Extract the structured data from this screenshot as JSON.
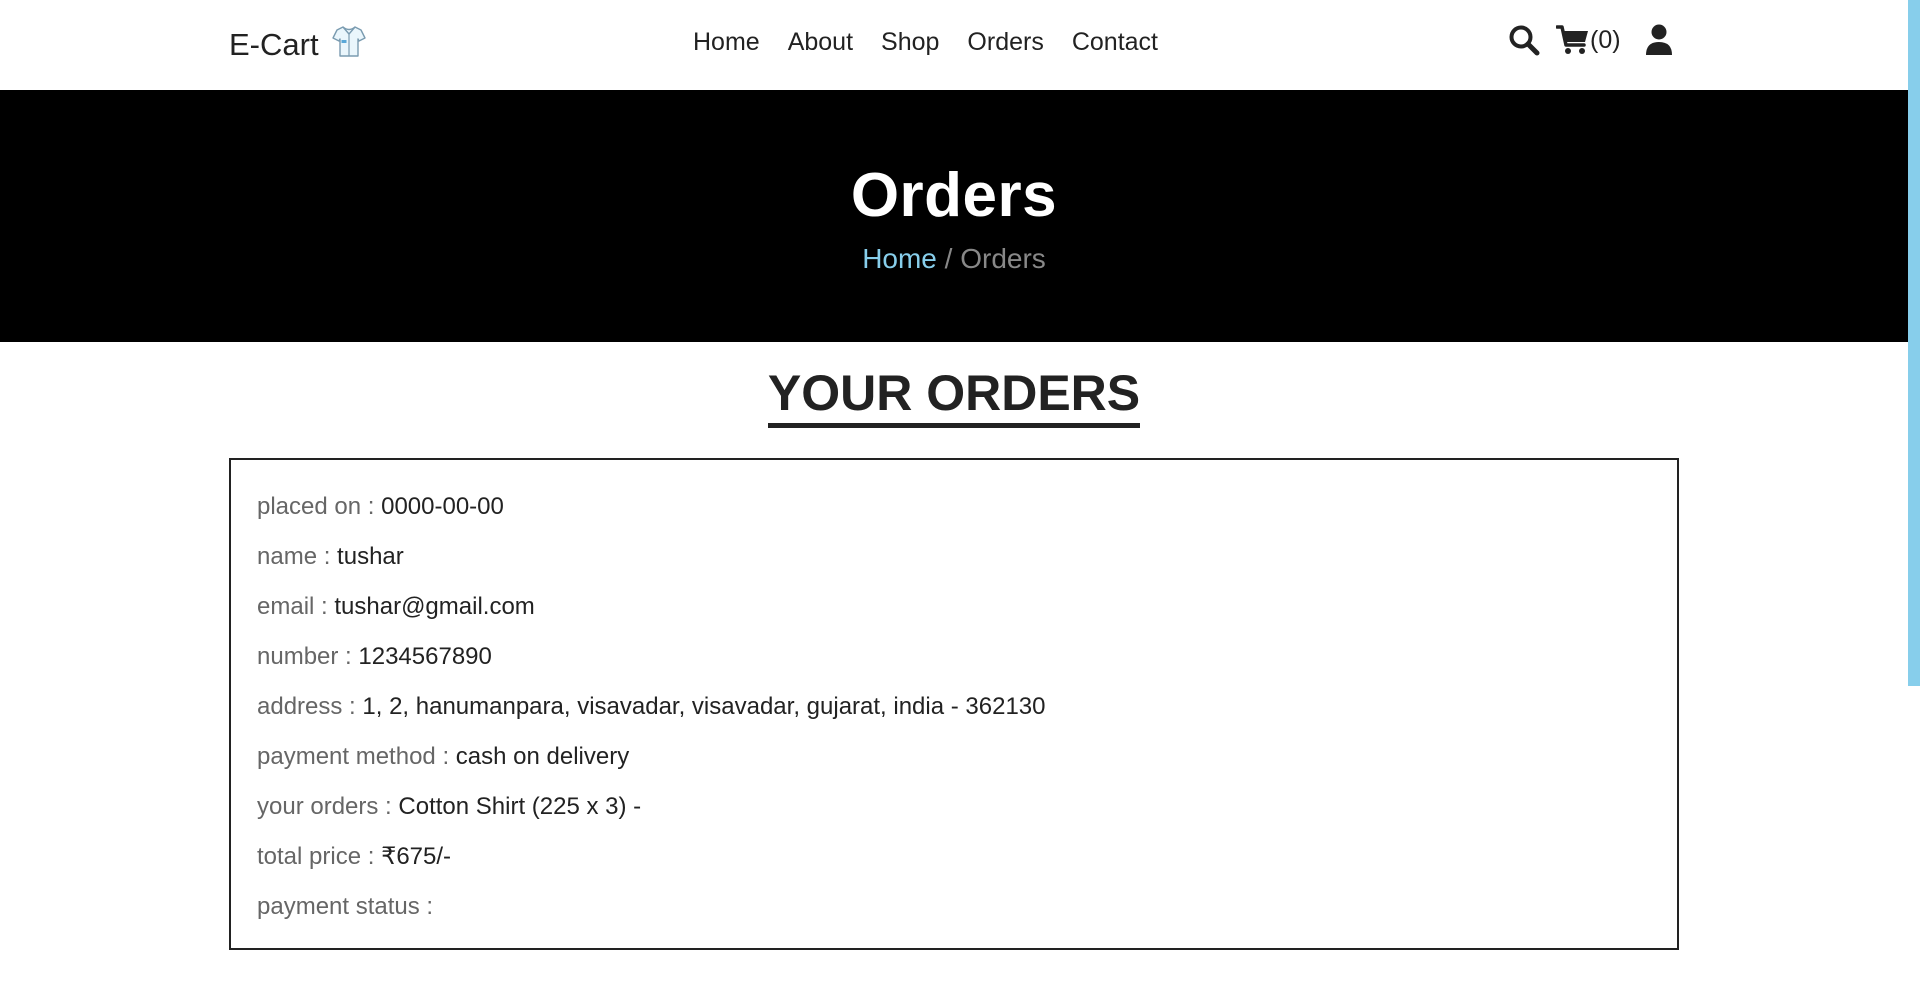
{
  "brand": {
    "name": "E-Cart",
    "icon": "shirt-icon"
  },
  "nav": {
    "items": [
      {
        "label": "Home"
      },
      {
        "label": "About"
      },
      {
        "label": "Shop"
      },
      {
        "label": "Orders"
      },
      {
        "label": "Contact"
      }
    ],
    "cart_count": "(0)"
  },
  "icons": {
    "search": "search-icon",
    "cart": "cart-icon",
    "user": "user-icon"
  },
  "hero": {
    "title": "Orders",
    "breadcrumb": {
      "home": "Home",
      "separator": " / ",
      "current": "Orders"
    }
  },
  "section_title": "YOUR ORDERS",
  "order": {
    "placed_on": {
      "label": "placed on : ",
      "value": "0000-00-00"
    },
    "name": {
      "label": "name : ",
      "value": "tushar"
    },
    "email": {
      "label": "email : ",
      "value": "tushar@gmail.com"
    },
    "number": {
      "label": "number : ",
      "value": "1234567890"
    },
    "address": {
      "label": "address : ",
      "value": "1, 2, hanumanpara, visavadar, visavadar, gujarat, india - 362130"
    },
    "payment_method": {
      "label": "payment method : ",
      "value": "cash on delivery"
    },
    "your_orders": {
      "label": "your orders : ",
      "value": "Cotton Shirt (225 x 3) -"
    },
    "total_price": {
      "label": "total price : ",
      "value": "₹675/-"
    },
    "payment_status": {
      "label": "payment status : ",
      "value": ""
    }
  },
  "colors": {
    "accent": "#87ceeb",
    "band": "#000000",
    "text": "#222222",
    "label": "#666666"
  }
}
